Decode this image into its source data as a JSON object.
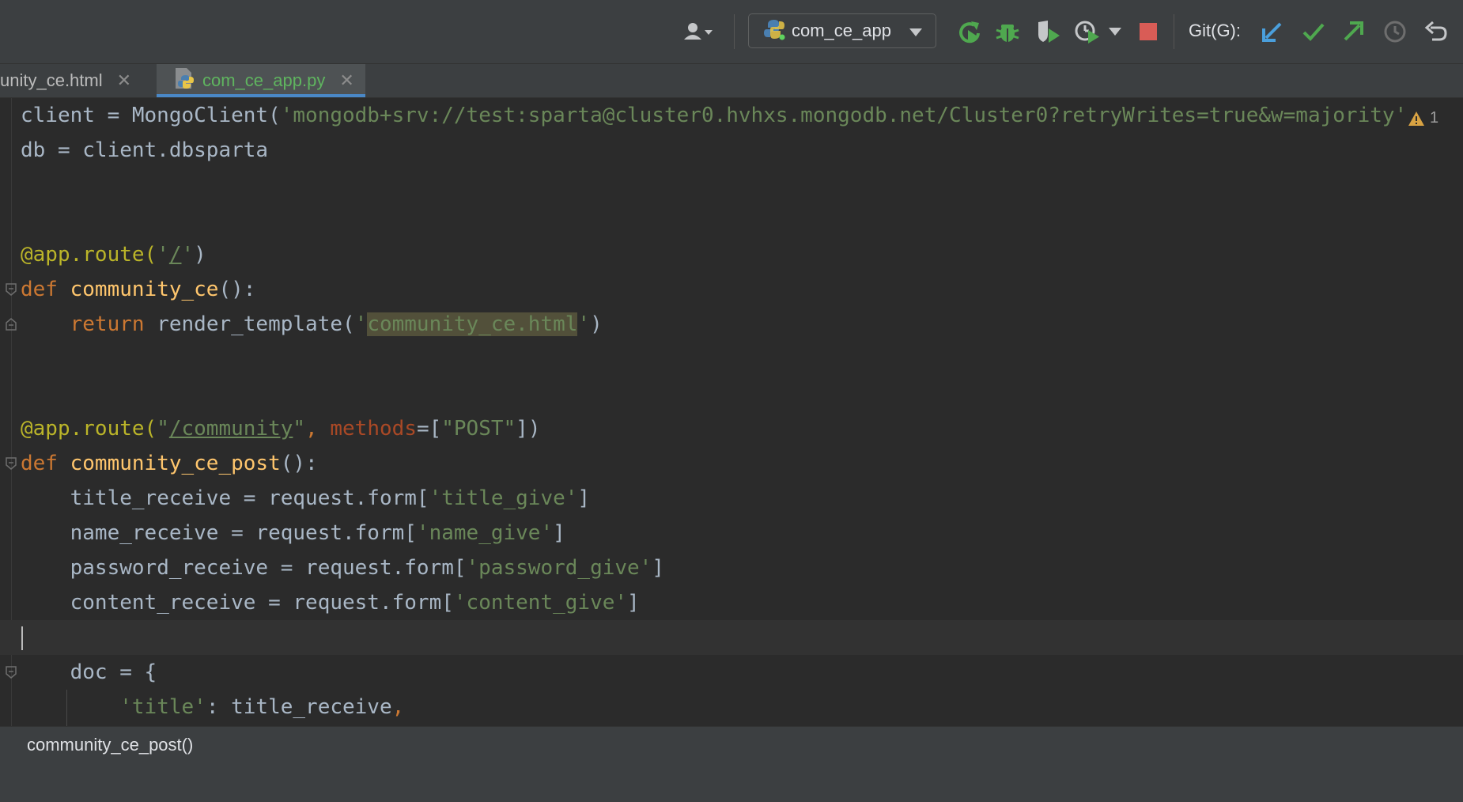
{
  "toolbar": {
    "run_config": "com_ce_app",
    "git_label": "Git(G):",
    "icons": [
      "user-icon",
      "python-icon",
      "rerun-icon",
      "debug-icon",
      "coverage-icon",
      "profile-icon",
      "stop-icon",
      "git-update-icon",
      "git-commit-icon",
      "git-push-icon",
      "history-icon",
      "rollback-icon"
    ],
    "colors": {
      "green": "#4fa84f",
      "red": "#d95c56",
      "blue": "#4a9fdc"
    }
  },
  "tabs": [
    {
      "label": "unity_ce.html",
      "active": false
    },
    {
      "label": "com_ce_app.py",
      "active": true
    }
  ],
  "editor": {
    "warnings_count": "1",
    "lines": {
      "l1_a": "client = MongoClient(",
      "l1_b": "'mongodb+srv://test:sparta@cluster0.hvhxs.mongodb.net/Cluster0?retryWrites=true&w=majority'",
      "l2": "db = client.dbsparta",
      "l5_deco": "@app.route(",
      "l5_q1": "'",
      "l5_path": "/",
      "l5_q2": "'",
      "l5_end": ")",
      "l6_kw": "def ",
      "l6_fn": "community_ce",
      "l6_end": "():",
      "l7_kw": "return ",
      "l7_call": "render_template(",
      "l7_q1": "'",
      "l7_str": "community_ce.html",
      "l7_q2": "'",
      "l7_end": ")",
      "l10_deco": "@app.route(",
      "l10_q1": "\"",
      "l10_path": "/community",
      "l10_q2": "\"",
      "l10_comma": ", ",
      "l10_param": "methods",
      "l10_eq": "=[",
      "l10_str": "\"POST\"",
      "l10_end": "])",
      "l11_kw": "def ",
      "l11_fn": "community_ce_post",
      "l11_end": "():",
      "l12_a": "title_receive = request.form[",
      "l12_s": "'title_give'",
      "l12_e": "]",
      "l13_a": "name_receive = request.form[",
      "l13_s": "'name_give'",
      "l13_e": "]",
      "l14_a": "password_receive = request.form[",
      "l14_s": "'password_give'",
      "l14_e": "]",
      "l15_a": "content_receive = request.form[",
      "l15_s": "'content_give'",
      "l15_e": "]",
      "l17": "doc = {",
      "l18_s": "'title'",
      "l18_a": ": title_receive",
      "l18_c": ","
    }
  },
  "breadcrumb": {
    "label": "community_ce_post()"
  }
}
